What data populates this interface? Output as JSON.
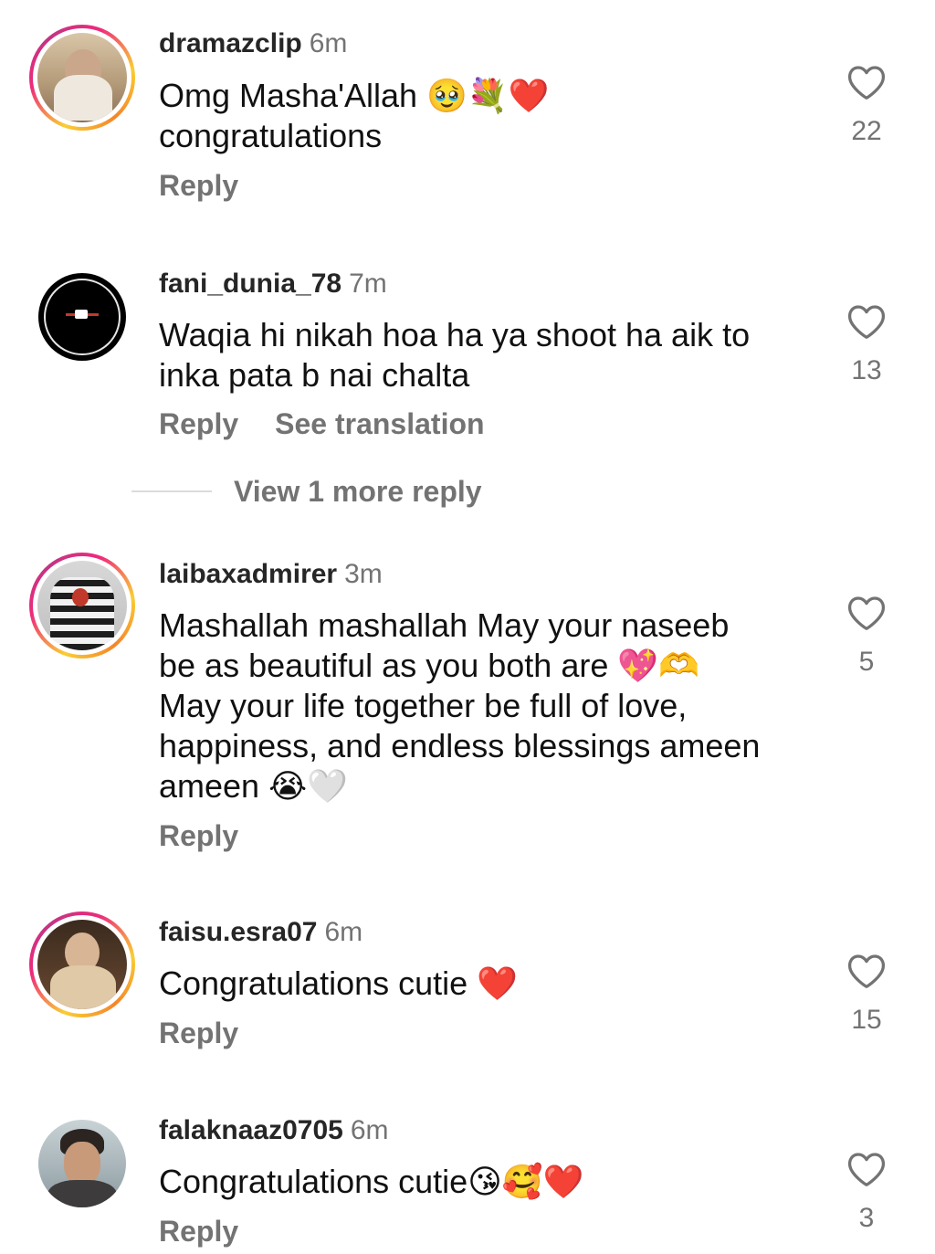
{
  "comments": [
    {
      "username": "dramazclip",
      "time": "6m",
      "lines": [
        "Omg Masha'Allah 🥹💐❤️",
        "congratulations"
      ],
      "reply_label": "Reply",
      "likes": "22"
    },
    {
      "username": "fani_dunia_78",
      "time": "7m",
      "lines": [
        "Waqia hi nikah hoa ha ya shoot ha aik to",
        "inka pata b nai chalta"
      ],
      "reply_label": "Reply",
      "translate_label": "See translation",
      "likes": "13"
    },
    {
      "username": "laibaxadmirer",
      "time": "3m",
      "lines": [
        "Mashallah mashallah May your naseeb",
        "be as beautiful as you both are 💖🫶",
        "May your life together be full of love,",
        "happiness, and endless blessings ameen",
        "ameen 😭🤍"
      ],
      "reply_label": "Reply",
      "likes": "5"
    },
    {
      "username": "faisu.esra07",
      "time": "6m",
      "lines": [
        "Congratulations cutie ❤️"
      ],
      "reply_label": "Reply",
      "likes": "15"
    },
    {
      "username": "falaknaaz0705",
      "time": "6m",
      "lines": [
        "Congratulations cutie😘🥰❤️"
      ],
      "reply_label": "Reply",
      "likes": "3"
    }
  ],
  "view_more_label": "View 1 more reply",
  "icons": {
    "like": "heart-outline-icon"
  },
  "colors": {
    "secondary_text": "#737373",
    "username": "#262626"
  }
}
